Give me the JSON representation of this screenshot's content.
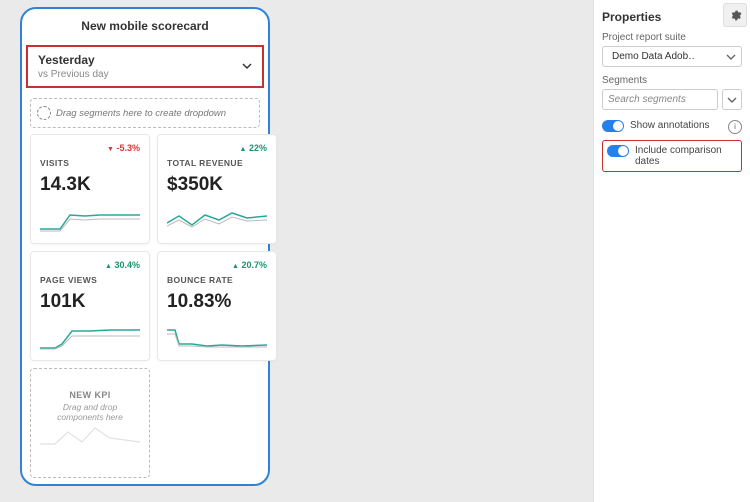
{
  "scorecard": {
    "title": "New mobile scorecard",
    "date_range": {
      "primary": "Yesterday",
      "comparison": "vs Previous day"
    },
    "segments_drop_hint": "Drag segments here to create dropdown",
    "cards": [
      {
        "label": "VISITS",
        "value": "14.3K",
        "delta": "-5.3%",
        "delta_dir": "neg",
        "accent": "#d93636"
      },
      {
        "label": "TOTAL REVENUE",
        "value": "$350K",
        "delta": "22%",
        "delta_dir": "pos",
        "accent": "#1a936f"
      },
      {
        "label": "PAGE VIEWS",
        "value": "101K",
        "delta": "30.4%",
        "delta_dir": "pos",
        "accent": "#1a936f"
      },
      {
        "label": "BOUNCE RATE",
        "value": "10.83%",
        "delta": "20.7%",
        "delta_dir": "pos",
        "accent": "#1a936f"
      }
    ],
    "new_kpi": {
      "label": "NEW KPI",
      "hint": "Drag and drop components here"
    }
  },
  "properties": {
    "title": "Properties",
    "report_suite_label": "Project report suite",
    "report_suite_value": "Demo Data Adob…",
    "segments_label": "Segments",
    "segments_placeholder": "Search segments",
    "toggles": {
      "show_annotations": "Show annotations",
      "include_comparison": "Include comparison dates"
    }
  },
  "chart_data": [
    {
      "type": "line",
      "card": "VISITS",
      "series": [
        {
          "name": "current",
          "values": [
            4,
            4,
            4,
            12,
            11,
            12,
            12
          ]
        },
        {
          "name": "prev",
          "values": [
            3,
            3,
            3,
            10,
            9,
            10,
            10
          ]
        }
      ]
    },
    {
      "type": "line",
      "card": "TOTAL REVENUE",
      "series": [
        {
          "name": "current",
          "values": [
            6,
            9,
            5,
            10,
            8,
            11,
            9
          ]
        },
        {
          "name": "prev",
          "values": [
            5,
            7,
            4,
            8,
            6,
            9,
            8
          ]
        }
      ]
    },
    {
      "type": "line",
      "card": "PAGE VIEWS",
      "series": [
        {
          "name": "current",
          "values": [
            2,
            2,
            4,
            11,
            11,
            12,
            12
          ]
        },
        {
          "name": "prev",
          "values": [
            2,
            2,
            3,
            9,
            9,
            9,
            9
          ]
        }
      ]
    },
    {
      "type": "line",
      "card": "BOUNCE RATE",
      "series": [
        {
          "name": "current",
          "values": [
            10,
            4,
            4,
            3,
            4,
            3,
            4
          ]
        },
        {
          "name": "prev",
          "values": [
            8,
            3,
            3,
            3,
            3,
            3,
            3
          ]
        }
      ]
    },
    {
      "type": "line",
      "card": "NEW KPI",
      "series": [
        {
          "name": "placeholder",
          "values": [
            3,
            3,
            8,
            4,
            10,
            6,
            5
          ]
        }
      ]
    }
  ]
}
